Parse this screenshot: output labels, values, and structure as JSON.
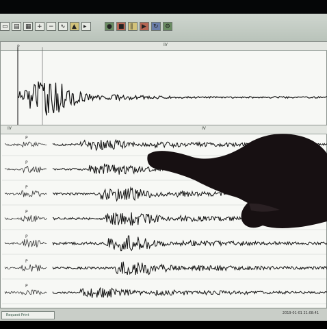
{
  "toolbar": {
    "buttons": [
      "open",
      "save",
      "print",
      "zoom-in",
      "zoom-out",
      "filter",
      "pick",
      "previous",
      "next",
      "settings",
      "help",
      "record",
      "stop",
      "pause",
      "play",
      "refresh"
    ]
  },
  "status_bar": {
    "left_text": "Request Print",
    "right_text": "2019-01-01 21:08:41"
  },
  "top_panel": {
    "label": "IV",
    "channel_mark": "P"
  },
  "bottom_panel": {
    "channels": [
      {
        "label": "P",
        "amplitude": 0.42,
        "noise": 0.1
      },
      {
        "label": "P",
        "amplitude": 0.45,
        "noise": 0.05
      },
      {
        "label": "P",
        "amplitude": 0.55,
        "noise": 0.1
      },
      {
        "label": "P",
        "amplitude": 0.55,
        "noise": 0.09
      },
      {
        "label": "P",
        "amplitude": 0.6,
        "noise": 0.16
      },
      {
        "label": "P",
        "amplitude": 0.55,
        "noise": 0.11
      },
      {
        "label": "P",
        "amplitude": 0.38,
        "noise": 0.04
      }
    ]
  },
  "colors": {
    "trace": "#111111",
    "background": "#f7f8f5",
    "hand": "#171012"
  }
}
